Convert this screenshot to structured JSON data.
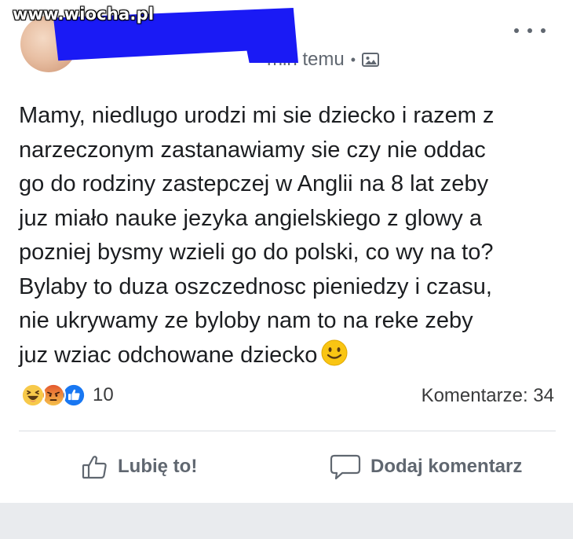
{
  "watermark": {
    "text": "www.wiocha.pl"
  },
  "post": {
    "timestamp": "min temu",
    "separator": "•",
    "privacy_icon": "photo-icon",
    "more_icon": "more-options-icon",
    "body": "Mamy, niedlugo urodzi mi sie dziecko i razem z\nnarzeczonym zastanawiamy sie czy nie oddac\ngo do rodziny zastepczej w Anglii na 8 lat zeby\njuz miało nauke jezyka angielskiego z glowy a\npozniej bysmy wzieli go do polski, co wy na to?\nBylaby to duza oszczednosc pieniedzy i czasu,\nnie ukrywamy ze byloby nam to na reke zeby\njuz wziac odchowane dziecko",
    "emoji": "slightly-smiling-face-emoji"
  },
  "engagement": {
    "reactions": [
      "haha-reaction-icon",
      "angry-reaction-icon",
      "like-reaction-icon"
    ],
    "reaction_count": "10",
    "comments": "Komentarze: 34"
  },
  "actions": {
    "like_label": "Lubię to!",
    "comment_label": "Dodaj komentarz"
  },
  "colors": {
    "redaction": "#1a1af5",
    "like_blue": "#1877f2",
    "angry_red": "#e4572e",
    "haha_yellow": "#f7c94a",
    "text_secondary": "#606770",
    "bottom_bar": "#e9ebee"
  }
}
